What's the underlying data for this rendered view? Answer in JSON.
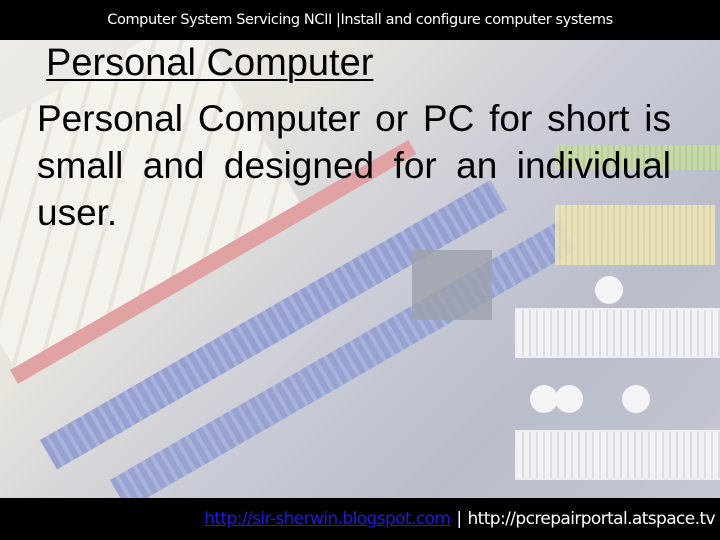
{
  "header": {
    "text": "Computer System Servicing NCII |Install and configure computer systems"
  },
  "slide": {
    "title": "Personal Computer",
    "body": "Personal Computer or PC for short is small and designed for an individual user."
  },
  "footer": {
    "link_text": "http://sir-sherwin.blogspot.com",
    "separator": "|",
    "url_text": "http://pcrepairportal.atspace.tv"
  },
  "colors": {
    "bar_background": "#000000",
    "link": "#1a1ae6",
    "text": "#000000"
  }
}
